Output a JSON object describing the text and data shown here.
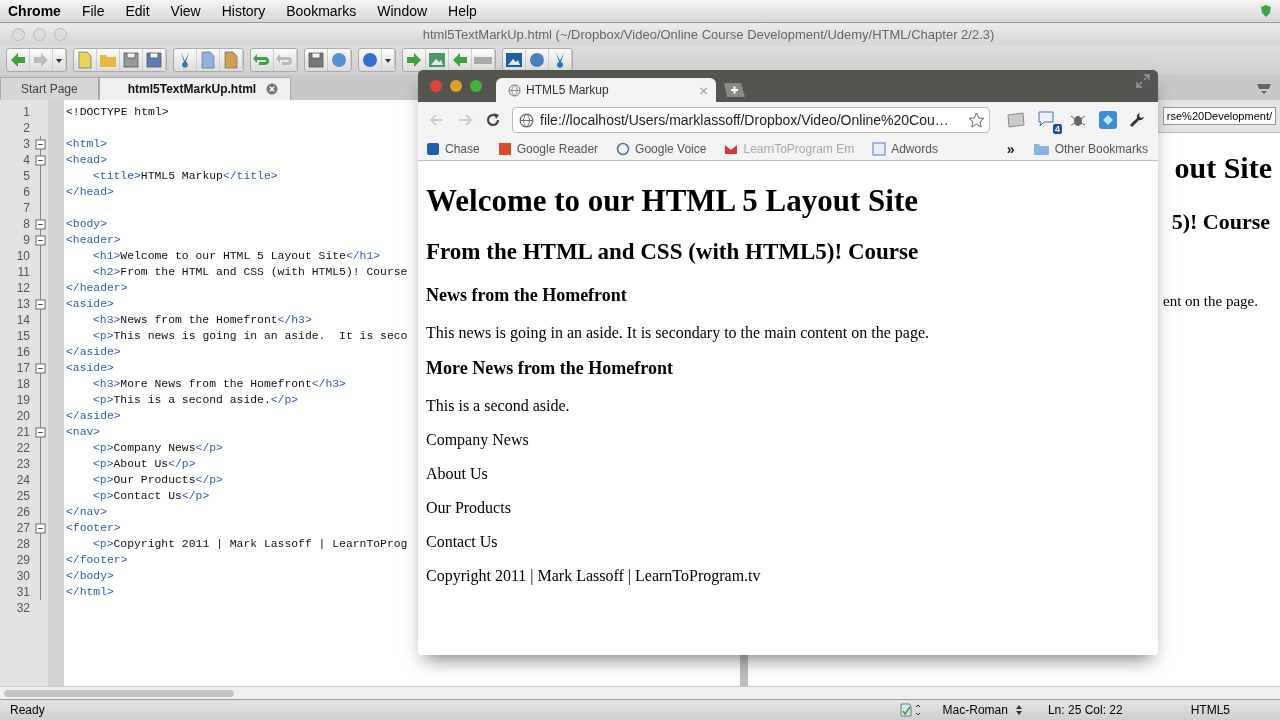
{
  "menu_bar": {
    "app": "Chrome",
    "items": [
      "File",
      "Edit",
      "View",
      "History",
      "Bookmarks",
      "Window",
      "Help"
    ]
  },
  "editor": {
    "title": "html5TextMarkUp.html (~/Dropbox/Video/Online Course Development/Udemy/HTML/Chapter 2/2.3)",
    "tabs": [
      {
        "label": "Start Page",
        "selected": false
      },
      {
        "label": "html5TextMarkUp.html",
        "selected": true
      }
    ],
    "code_lines": [
      {
        "number": "1",
        "indented": false,
        "foldable": false,
        "segments": [
          {
            "kind": "text",
            "text": "<!DOCTYPE html>"
          }
        ]
      },
      {
        "number": "2",
        "foldable": false
      },
      {
        "number": "3",
        "indented": false,
        "foldable": true,
        "segments": [
          {
            "kind": "tag",
            "text": "<html>"
          }
        ]
      },
      {
        "number": "4",
        "indented": false,
        "foldable": true,
        "segments": [
          {
            "kind": "tag",
            "text": "<head>"
          }
        ]
      },
      {
        "number": "5",
        "indented": true,
        "foldable": false,
        "segments": [
          {
            "kind": "tag",
            "text": "<title>"
          },
          {
            "kind": "text",
            "text": "HTML5 Markup"
          },
          {
            "kind": "tag",
            "text": "</title>"
          }
        ]
      },
      {
        "number": "6",
        "indented": false,
        "foldable": false,
        "segments": [
          {
            "kind": "tag",
            "text": "</head>"
          }
        ]
      },
      {
        "number": "7",
        "foldable": false
      },
      {
        "number": "8",
        "indented": false,
        "foldable": true,
        "segments": [
          {
            "kind": "tag",
            "text": "<body>"
          }
        ]
      },
      {
        "number": "9",
        "indented": false,
        "foldable": true,
        "segments": [
          {
            "kind": "tag",
            "text": "<header>"
          }
        ]
      },
      {
        "number": "10",
        "indented": true,
        "foldable": false,
        "segments": [
          {
            "kind": "tag",
            "text": "<h1>"
          },
          {
            "kind": "text",
            "text": "Welcome to our HTML 5 Layout Site"
          },
          {
            "kind": "tag",
            "text": "</h1>"
          }
        ]
      },
      {
        "number": "11",
        "indented": true,
        "foldable": false,
        "segments": [
          {
            "kind": "tag",
            "text": "<h2>"
          },
          {
            "kind": "text",
            "text": "From the HTML and CSS (with HTML5)! Course"
          }
        ]
      },
      {
        "number": "12",
        "indented": false,
        "foldable": false,
        "segments": [
          {
            "kind": "tag",
            "text": "</header>"
          }
        ]
      },
      {
        "number": "13",
        "indented": false,
        "foldable": true,
        "segments": [
          {
            "kind": "tag",
            "text": "<aside>"
          }
        ]
      },
      {
        "number": "14",
        "indented": true,
        "foldable": false,
        "segments": [
          {
            "kind": "tag",
            "text": "<h3>"
          },
          {
            "kind": "text",
            "text": "News from the Homefront"
          },
          {
            "kind": "tag",
            "text": "</h3>"
          }
        ]
      },
      {
        "number": "15",
        "indented": true,
        "foldable": false,
        "segments": [
          {
            "kind": "tag",
            "text": "<p>"
          },
          {
            "kind": "text",
            "text": "This news is going in an aside.  It is seco"
          }
        ]
      },
      {
        "number": "16",
        "indented": false,
        "foldable": false,
        "segments": [
          {
            "kind": "tag",
            "text": "</aside>"
          }
        ]
      },
      {
        "number": "17",
        "indented": false,
        "foldable": true,
        "segments": [
          {
            "kind": "tag",
            "text": "<aside>"
          }
        ]
      },
      {
        "number": "18",
        "indented": true,
        "foldable": false,
        "segments": [
          {
            "kind": "tag",
            "text": "<h3>"
          },
          {
            "kind": "text",
            "text": "More News from the Homefront"
          },
          {
            "kind": "tag",
            "text": "</h3>"
          }
        ]
      },
      {
        "number": "19",
        "indented": true,
        "foldable": false,
        "segments": [
          {
            "kind": "tag",
            "text": "<p>"
          },
          {
            "kind": "text",
            "text": "This is a second aside."
          },
          {
            "kind": "tag",
            "text": "</p>"
          }
        ]
      },
      {
        "number": "20",
        "indented": false,
        "foldable": false,
        "segments": [
          {
            "kind": "tag",
            "text": "</aside>"
          }
        ]
      },
      {
        "number": "21",
        "indented": false,
        "foldable": true,
        "segments": [
          {
            "kind": "tag",
            "text": "<nav>"
          }
        ]
      },
      {
        "number": "22",
        "indented": true,
        "foldable": false,
        "segments": [
          {
            "kind": "tag",
            "text": "<p>"
          },
          {
            "kind": "text",
            "text": "Company News"
          },
          {
            "kind": "tag",
            "text": "</p>"
          }
        ]
      },
      {
        "number": "23",
        "indented": true,
        "foldable": false,
        "segments": [
          {
            "kind": "tag",
            "text": "<p>"
          },
          {
            "kind": "text",
            "text": "About Us"
          },
          {
            "kind": "tag",
            "text": "</p>"
          }
        ]
      },
      {
        "number": "24",
        "indented": true,
        "foldable": false,
        "segments": [
          {
            "kind": "tag",
            "text": "<p>"
          },
          {
            "kind": "text",
            "text": "Our Products"
          },
          {
            "kind": "tag",
            "text": "</p>"
          }
        ]
      },
      {
        "number": "25",
        "indented": true,
        "foldable": false,
        "segments": [
          {
            "kind": "tag",
            "text": "<p>"
          },
          {
            "kind": "text",
            "text": "Contact Us"
          },
          {
            "kind": "tag",
            "text": "</p>"
          }
        ]
      },
      {
        "number": "26",
        "indented": false,
        "foldable": false,
        "segments": [
          {
            "kind": "tag",
            "text": "</nav>"
          }
        ]
      },
      {
        "number": "27",
        "indented": false,
        "foldable": true,
        "segments": [
          {
            "kind": "tag",
            "text": "<footer>"
          }
        ]
      },
      {
        "number": "28",
        "indented": true,
        "foldable": false,
        "segments": [
          {
            "kind": "tag",
            "text": "<p>"
          },
          {
            "kind": "text",
            "text": "Copyright 2011 | Mark Lassoff | LearnToProg"
          }
        ]
      },
      {
        "number": "29",
        "indented": false,
        "foldable": false,
        "segments": [
          {
            "kind": "tag",
            "text": "</footer>"
          }
        ]
      },
      {
        "number": "30",
        "indented": false,
        "foldable": false,
        "segments": [
          {
            "kind": "tag",
            "text": "</body>"
          }
        ]
      },
      {
        "number": "31",
        "indented": false,
        "foldable": false,
        "segments": [
          {
            "kind": "tag",
            "text": "</html>"
          }
        ]
      },
      {
        "number": "32",
        "foldable": false
      }
    ],
    "preview": {
      "url": "rse%20Development/",
      "heading": "out Site",
      "subheading": "5)! Course",
      "paragraph": "ent on the page."
    },
    "status_bar": {
      "status": "Ready",
      "encoding": "Mac-Roman",
      "position": "Ln: 25 Col: 22",
      "language": "HTML5"
    }
  },
  "browser": {
    "tab": {
      "title": "HTML5 Markup",
      "close": "×"
    },
    "address": "file://localhost/Users/marklassoff/Dropbox/Video/Online%20Cou…",
    "extension_badge": "4",
    "bookmarks": [
      {
        "label": "Chase",
        "faded": false
      },
      {
        "label": "Google Reader",
        "faded": false
      },
      {
        "label": "Google Voice",
        "faded": false
      },
      {
        "label": "LearnToProgram Em",
        "faded": true
      },
      {
        "label": "Adwords",
        "faded": false
      }
    ],
    "more_bookmarks": "»",
    "other_bookmarks": "Other Bookmarks",
    "page": [
      {
        "kind": "h1",
        "text": "Welcome to our HTML 5 Layout Site"
      },
      {
        "kind": "h2",
        "text": "From the HTML and CSS (with HTML5)! Course"
      },
      {
        "kind": "h3",
        "text": "News from the Homefront"
      },
      {
        "kind": "p",
        "text": "This news is going in an aside. It is secondary to the main content on the page."
      },
      {
        "kind": "h3",
        "text": "More News from the Homefront"
      },
      {
        "kind": "p",
        "text": "This is a second aside."
      },
      {
        "kind": "p",
        "text": "Company News"
      },
      {
        "kind": "p",
        "text": "About Us"
      },
      {
        "kind": "p",
        "text": "Our Products"
      },
      {
        "kind": "p",
        "text": "Contact Us"
      },
      {
        "kind": "p",
        "text": "Copyright 2011 | Mark Lassoff | LearnToProgram.tv"
      }
    ]
  }
}
